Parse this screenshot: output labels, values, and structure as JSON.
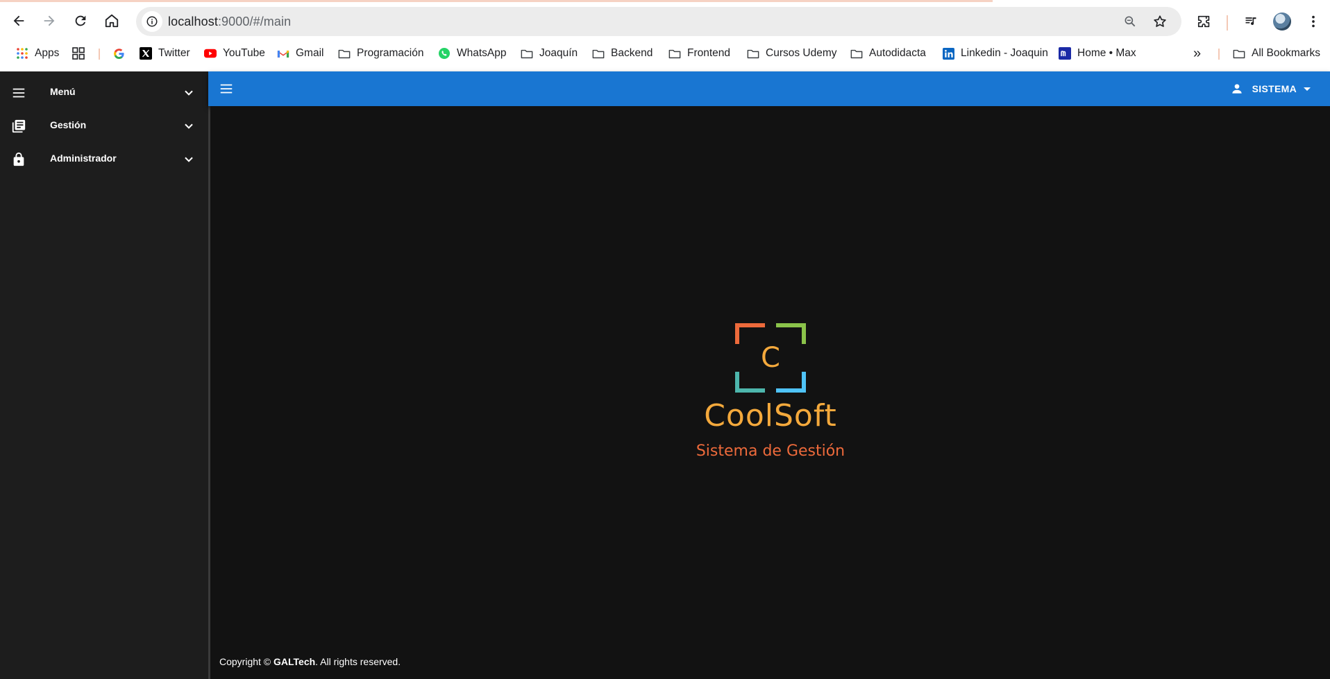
{
  "browser": {
    "url_host": "localhost",
    "url_path": ":9000/#/main",
    "icons": {
      "back": "arrow-left-icon",
      "forward": "arrow-right-icon",
      "reload": "reload-icon",
      "home": "home-icon",
      "site_info": "info-icon",
      "zoom": "zoom-icon",
      "bookmark": "star-icon",
      "extensions": "puzzle-icon",
      "media": "media-queue-icon",
      "profile": "avatar",
      "menu": "kebab-menu-icon"
    },
    "bookmarks": [
      {
        "label": "Apps",
        "icon": "apps-grid-icon"
      },
      {
        "label": "",
        "icon": "tab-groups-icon"
      },
      {
        "label": "",
        "icon": "google-icon"
      },
      {
        "label": "Twitter",
        "icon": "x-icon"
      },
      {
        "label": "YouTube",
        "icon": "youtube-icon"
      },
      {
        "label": "Gmail",
        "icon": "gmail-icon"
      },
      {
        "label": "Programación",
        "icon": "folder-icon"
      },
      {
        "label": "WhatsApp",
        "icon": "whatsapp-icon"
      },
      {
        "label": "Joaquín",
        "icon": "folder-icon"
      },
      {
        "label": "Backend",
        "icon": "folder-icon"
      },
      {
        "label": "Frontend",
        "icon": "folder-icon"
      },
      {
        "label": "Cursos Udemy",
        "icon": "folder-icon"
      },
      {
        "label": "Autodidacta",
        "icon": "folder-icon"
      },
      {
        "label": "Linkedin - Joaquin",
        "icon": "linkedin-icon"
      },
      {
        "label": "Home • Max",
        "icon": "max-icon"
      }
    ],
    "overflow_label": "»",
    "all_bookmarks_label": "All Bookmarks"
  },
  "sidebar": {
    "items": [
      {
        "label": "Menú",
        "icon": "hamburger-icon"
      },
      {
        "label": "Gestión",
        "icon": "library-icon"
      },
      {
        "label": "Administrador",
        "icon": "lock-icon"
      }
    ]
  },
  "topbar": {
    "user_label": "SISTEMA",
    "colors": {
      "bar": "#1976d2"
    }
  },
  "brand": {
    "logo_letter": "C",
    "name": "CoolSoft",
    "tagline": "Sistema de Gestión",
    "colors": {
      "orange": "#ed6a3b",
      "green": "#8bc34a",
      "teal": "#4db6ac",
      "blue": "#4fc3f7",
      "gold": "#f4a93c"
    }
  },
  "footer": {
    "prefix": "Copyright ©",
    "company": "GALTech",
    "suffix": ". All rights reserved."
  }
}
